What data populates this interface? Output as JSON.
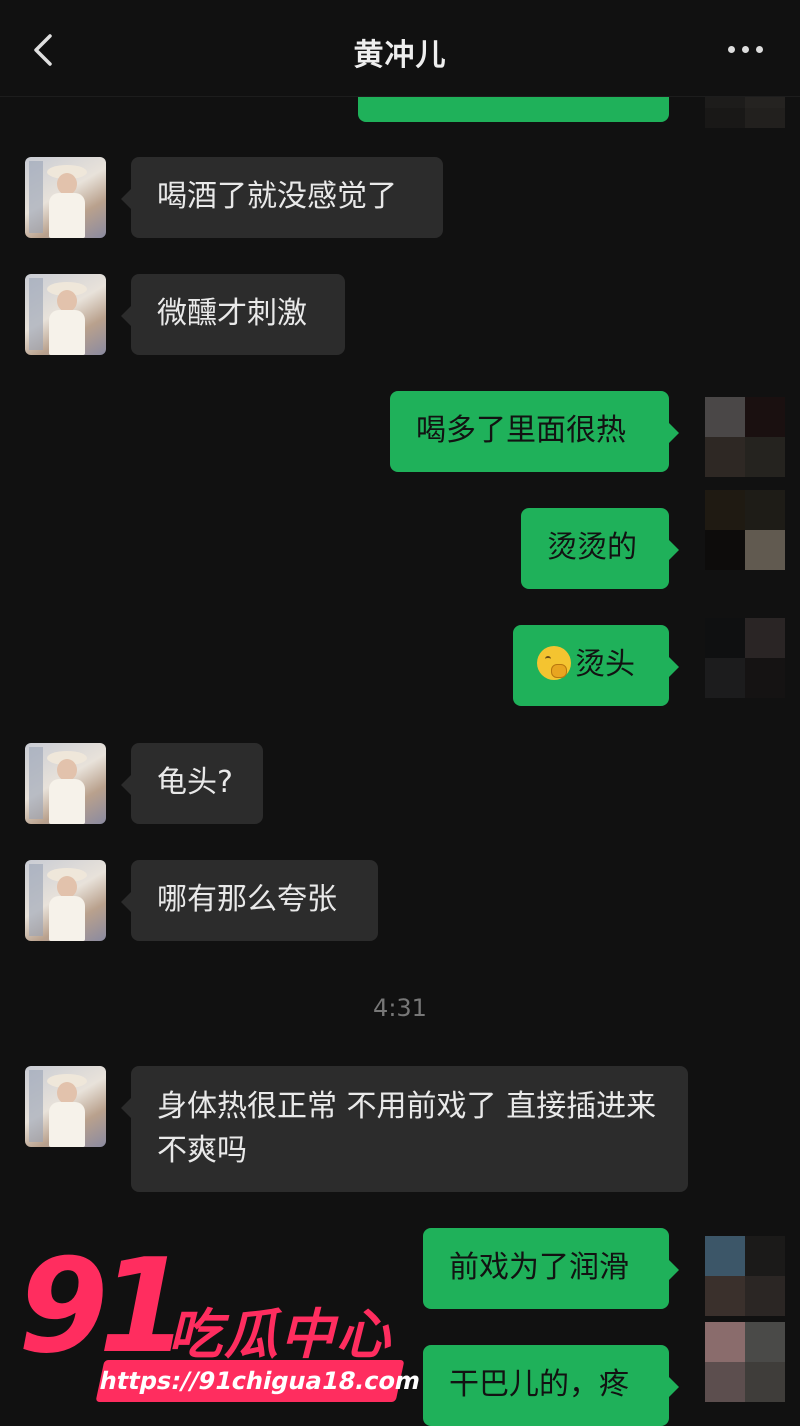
{
  "header": {
    "title": "黄冲儿"
  },
  "messages": [
    {
      "side": "in",
      "text": "喝酒了就没感觉了"
    },
    {
      "side": "in",
      "text": "微醺才刺激"
    },
    {
      "side": "out",
      "text": "喝多了里面很热"
    },
    {
      "side": "out",
      "text": "烫烫的"
    },
    {
      "side": "out",
      "text": "烫头",
      "emoji": "thinking-face-icon"
    },
    {
      "side": "in",
      "text": "龟头?"
    },
    {
      "side": "in",
      "text": "哪有那么夸张"
    },
    {
      "side": "in",
      "text": "身体热很正常 不用前戏了 直接插进来不爽吗"
    },
    {
      "side": "out",
      "text": "前戏为了润滑"
    },
    {
      "side": "out",
      "text": "干巴儿的，疼"
    }
  ],
  "timestamp": "4:31",
  "watermark": {
    "brand_number": "91",
    "brand_name": "吃瓜中心",
    "url": "https://91chigua18.com"
  },
  "colors": {
    "background": "#111111",
    "incoming_bubble": "#2c2c2c",
    "outgoing_bubble": "#1fb15a",
    "watermark": "#ff2d5f"
  }
}
